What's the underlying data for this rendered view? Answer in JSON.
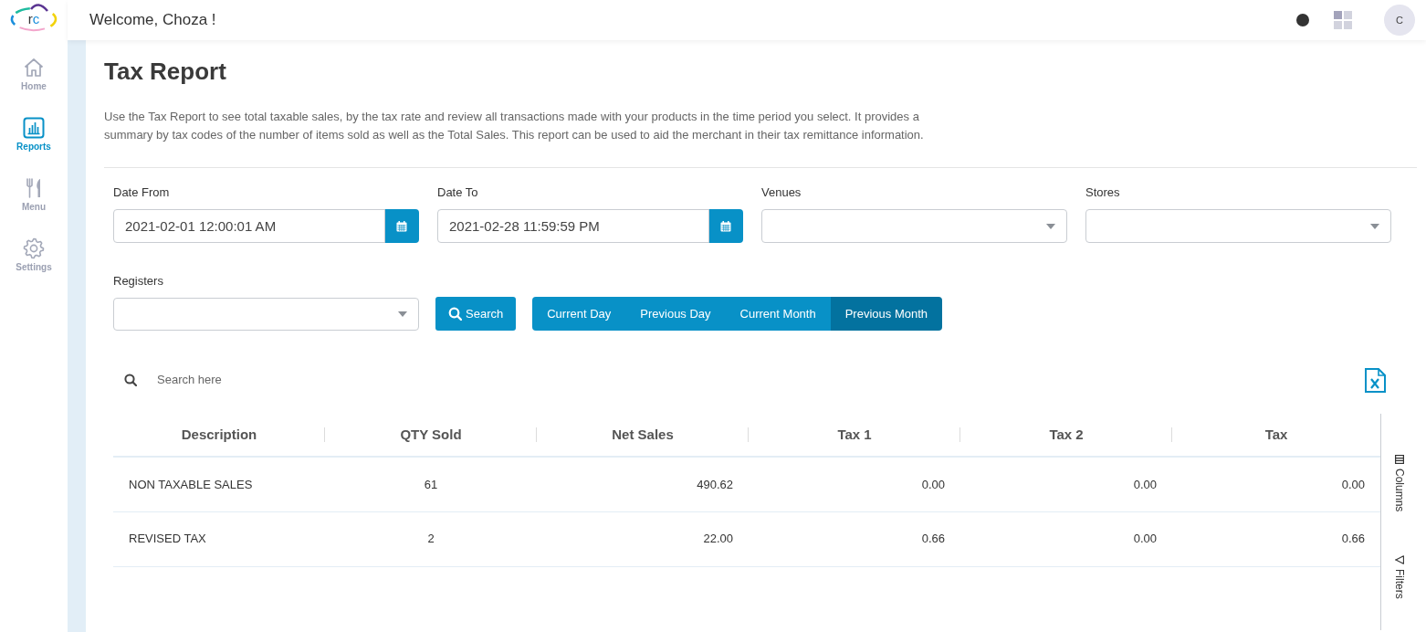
{
  "sidebar": {
    "logo": "rc",
    "items": [
      {
        "kind": "home",
        "label": "Home",
        "selected": false
      },
      {
        "kind": "reports",
        "label": "Reports",
        "selected": true
      },
      {
        "kind": "menu",
        "label": "Menu",
        "selected": false
      },
      {
        "kind": "settings",
        "label": "Settings",
        "selected": false
      }
    ]
  },
  "header": {
    "greeting": "Welcome, Choza !",
    "avatar": "C"
  },
  "page": {
    "title": "Tax Report",
    "description": "Use the Tax Report to see total taxable sales, by the tax rate and review all transactions made with your products in the time period you select. It provides a summary by tax codes of the number of items sold as well as the Total Sales. This report can be used to aid the merchant in their tax remittance information."
  },
  "filter_rows": [
    [
      {
        "kind": "date",
        "label": "Date From",
        "value": "2021-02-01 12:00:01 AM"
      },
      {
        "kind": "date",
        "label": "Date To",
        "value": "2021-02-28 11:59:59 PM"
      },
      {
        "kind": "select",
        "label": "Venues"
      },
      {
        "kind": "select",
        "label": "Stores"
      }
    ],
    [
      {
        "kind": "select",
        "label": "Registers"
      }
    ]
  ],
  "search_button": "Search",
  "periods": [
    {
      "label": "Current Day",
      "selected": false
    },
    {
      "label": "Previous Day",
      "selected": false
    },
    {
      "label": "Current Month",
      "selected": false
    },
    {
      "label": "Previous Month",
      "selected": true
    }
  ],
  "table": {
    "search": {
      "placeholder": "Search here"
    },
    "columns": [
      "Description",
      "QTY Sold",
      "Net Sales",
      "Tax 1",
      "Tax 2",
      "Tax"
    ],
    "rows": [
      [
        "NON TAXABLE SALES",
        "61",
        "490.62",
        "0.00",
        "0.00",
        "0.00"
      ],
      [
        "REVISED TAX",
        "2",
        "22.00",
        "0.66",
        "0.00",
        "0.66"
      ]
    ]
  },
  "side_panel": [
    {
      "kind": "columns",
      "label": "Columns"
    },
    {
      "kind": "filters",
      "label": "Filters"
    }
  ]
}
